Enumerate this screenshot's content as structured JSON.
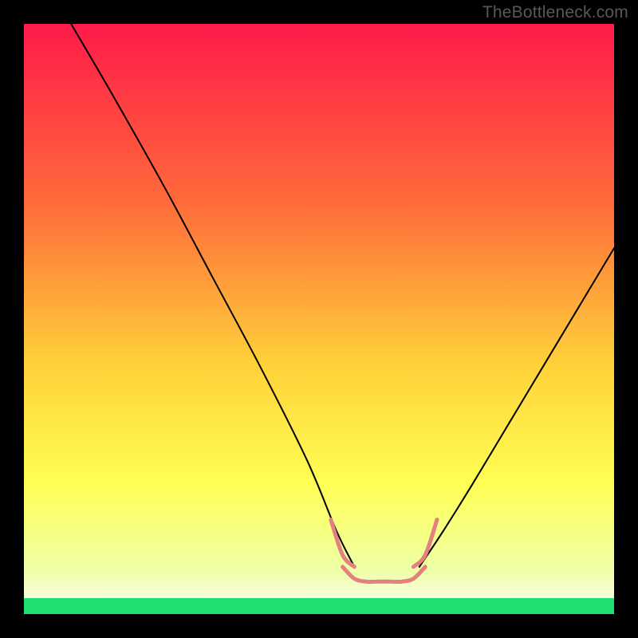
{
  "watermark": "TheBottleneck.com",
  "gradient": {
    "top": "#ff1a4a",
    "mid1": "#ff6a3a",
    "mid2": "#ffd23a",
    "mid3": "#ffff55",
    "mid4": "#eeffaa",
    "bottom_band": "#20e070"
  },
  "chart_data": {
    "type": "line",
    "title": "",
    "xlabel": "",
    "ylabel": "",
    "xlim": [
      0,
      100
    ],
    "ylim": [
      0,
      100
    ],
    "grid": false,
    "legend": false,
    "series": [
      {
        "name": "left-curve",
        "color": "#000000",
        "x": [
          8,
          15,
          24,
          32,
          40,
          48,
          53,
          56
        ],
        "y": [
          100,
          88,
          72,
          57,
          42,
          26,
          14,
          8
        ]
      },
      {
        "name": "right-curve",
        "color": "#000000",
        "x": [
          67,
          71,
          76,
          82,
          88,
          94,
          100
        ],
        "y": [
          8,
          14,
          22,
          32,
          42,
          52,
          62
        ]
      },
      {
        "name": "flat-bottom",
        "color": "#e58080",
        "stroke_width": 5,
        "x": [
          54,
          56,
          58,
          60,
          62,
          64,
          66,
          68
        ],
        "y": [
          8,
          6,
          5.5,
          5.5,
          5.5,
          5.5,
          6,
          8
        ]
      },
      {
        "name": "left-elbow-marker",
        "color": "#e58080",
        "stroke_width": 5,
        "x": [
          52,
          54,
          56
        ],
        "y": [
          16,
          10,
          8
        ]
      },
      {
        "name": "right-elbow-marker",
        "color": "#e58080",
        "stroke_width": 5,
        "x": [
          66,
          68,
          70
        ],
        "y": [
          8,
          10,
          16
        ]
      }
    ]
  }
}
